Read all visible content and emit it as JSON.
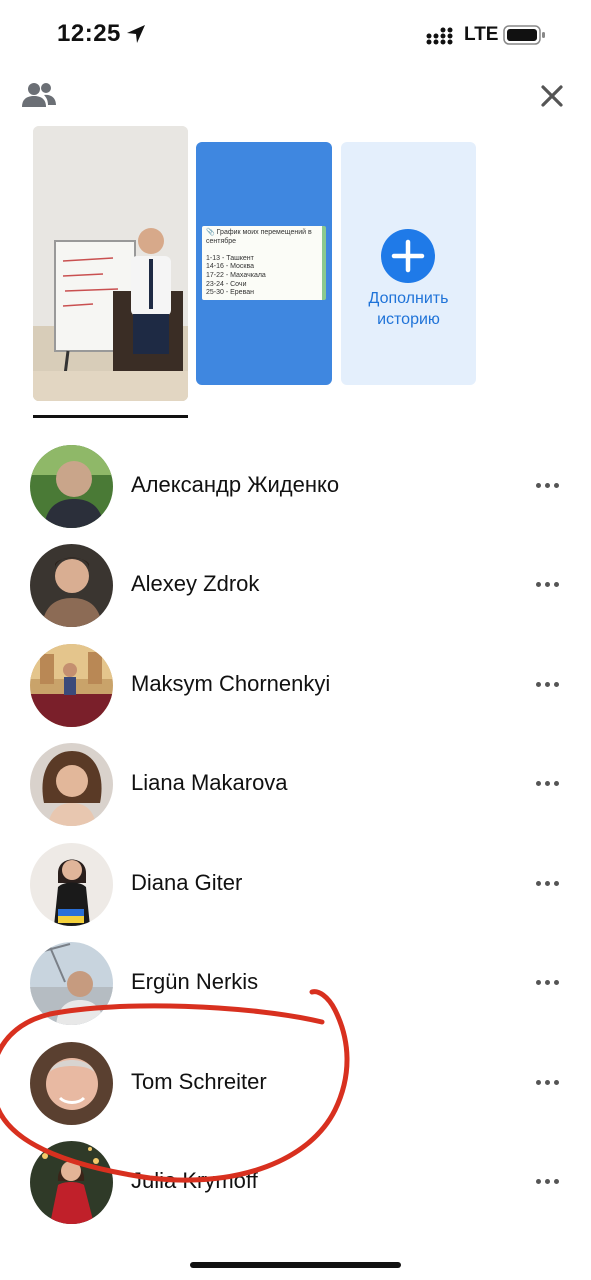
{
  "status": {
    "time": "12:25",
    "network": "LTE"
  },
  "stories": {
    "note_lines": [
      "📎 График моих перемещений в",
      "сентябре",
      "",
      "1-13 - Ташкент",
      "14-16 - Москва",
      "17-22 - Махачкала",
      "23-24 - Сочи",
      "25-30 - Ереван"
    ],
    "add_label_line1": "Дополнить",
    "add_label_line2": "историю"
  },
  "viewers": [
    {
      "name": "Александр Жиденко"
    },
    {
      "name": "Alexey Zdrok"
    },
    {
      "name": "Maksym Chornenkyi"
    },
    {
      "name": "Liana Makarova"
    },
    {
      "name": "Diana Giter"
    },
    {
      "name": "Ergün Nerkis"
    },
    {
      "name": "Tom Schreiter"
    },
    {
      "name": "Julia Krymoff"
    }
  ],
  "colors": {
    "accent": "#1f7ae8",
    "story_blue": "#3f87e0",
    "annotation": "#d8301f"
  }
}
